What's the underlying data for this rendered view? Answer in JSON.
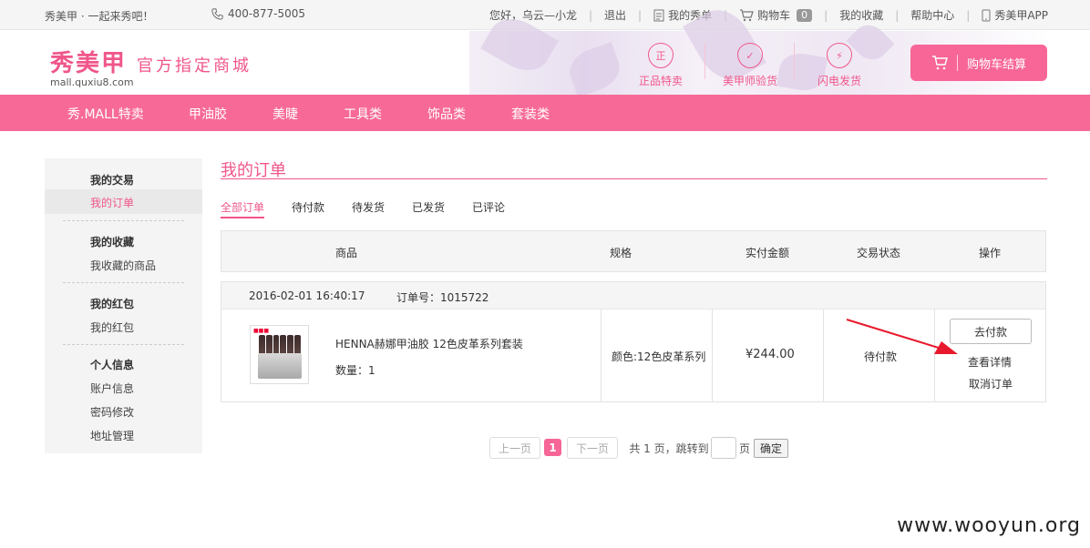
{
  "topbar": {
    "slogan": "秀美甲 · 一起来秀吧！",
    "phone": "400-877-5005",
    "greeting": "您好，乌云—小龙",
    "logout": "退出",
    "my_orders": "我的秀单",
    "cart": "购物车",
    "cart_count": "0",
    "favorites": "我的收藏",
    "help": "帮助中心",
    "app": "秀美甲APP"
  },
  "header": {
    "brand": "秀美甲",
    "tagline": "官方指定商城",
    "url": "mall.quxiu8.com",
    "features": [
      {
        "icon": "正",
        "label": "正品特卖"
      },
      {
        "icon": "✓",
        "label": "美甲师验货"
      },
      {
        "icon": "⚡",
        "label": "闪电发货"
      }
    ],
    "cart_button": "购物车结算"
  },
  "nav": {
    "items": [
      "秀.MALL特卖",
      "甲油胶",
      "美睫",
      "工具类",
      "饰品类",
      "套装类"
    ]
  },
  "sidebar": {
    "groups": [
      {
        "title": "我的交易",
        "links": [
          "我的订单"
        ]
      },
      {
        "title": "我的收藏",
        "links": [
          "我收藏的商品"
        ]
      },
      {
        "title": "我的红包",
        "links": [
          "我的红包"
        ]
      },
      {
        "title": "个人信息",
        "links": [
          "账户信息",
          "密码修改",
          "地址管理"
        ]
      }
    ],
    "active": "我的订单"
  },
  "main": {
    "title": "我的订单",
    "tabs": [
      "全部订单",
      "待付款",
      "待发货",
      "已发货",
      "已评论"
    ],
    "active_tab": "全部订单",
    "columns": [
      "商品",
      "规格",
      "实付金额",
      "交易状态",
      "操作"
    ]
  },
  "order": {
    "datetime": "2016-02-01 16:40:17",
    "order_no": "订单号：1015722",
    "product_name": "HENNA赫娜甲油胶 12色皮革系列套装",
    "quantity": "数量：1",
    "spec": "颜色:12色皮革系列",
    "amount": "¥244.00",
    "status": "待付款",
    "actions": {
      "pay": "去付款",
      "details": "查看详情",
      "cancel": "取消订单"
    }
  },
  "pagination": {
    "prev": "上一页",
    "current": "1",
    "next": "下一页",
    "summary": "共 1 页，跳转到",
    "page_unit": "页",
    "confirm": "确定"
  },
  "watermark": "www.wooyun.org",
  "colors": {
    "accent": "#f0568a",
    "nav": "#f76a97",
    "arrow": "#e8192c"
  }
}
